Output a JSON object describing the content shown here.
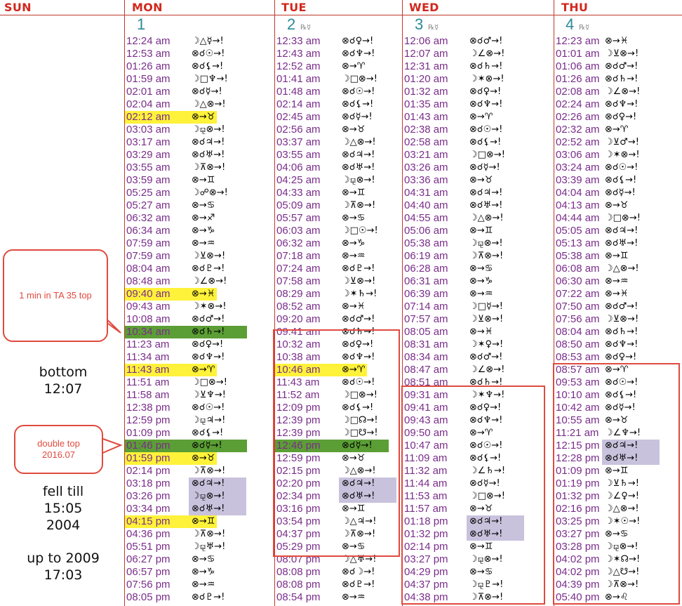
{
  "days": [
    {
      "name": "SUN",
      "num": "",
      "rx": ""
    },
    {
      "name": "MON",
      "num": "1",
      "rx": ""
    },
    {
      "name": "TUE",
      "num": "2",
      "rx": "℞☿"
    },
    {
      "name": "WED",
      "num": "3",
      "rx": "℞☿"
    },
    {
      "name": "THU",
      "num": "4",
      "rx": "℞☿"
    }
  ],
  "notes": {
    "bubble1": "1 min in TA 35 top",
    "bottom": "bottom\n12:07",
    "bubble2": "double top 2016.07",
    "fell": "fell till\n15:05\n2004",
    "upto": "up to 2009\n17:03"
  },
  "columns": [
    {
      "day": "MON",
      "rows": [
        {
          "t": "12:24 am",
          "a": "☽△☿→!"
        },
        {
          "t": "12:53 am",
          "a": "⊗☌☉→!"
        },
        {
          "t": "01:26 am",
          "a": "⊗☌⚸→!"
        },
        {
          "t": "01:59 am",
          "a": "☽□♆→!"
        },
        {
          "t": "02:01 am",
          "a": "⊗☌☿→!"
        },
        {
          "t": "02:04 am",
          "a": "☽△⊗→!"
        },
        {
          "t": "02:12 am",
          "a": "⊗→♉",
          "hl": "y"
        },
        {
          "t": "03:03 am",
          "a": "☽⚼⊗→!"
        },
        {
          "t": "03:17 am",
          "a": "⊗☌♃→!"
        },
        {
          "t": "03:29 am",
          "a": "⊗☌♅→!"
        },
        {
          "t": "03:55 am",
          "a": "☽⊼⊗→!"
        },
        {
          "t": "03:59 am",
          "a": "⊗→♊"
        },
        {
          "t": "05:25 am",
          "a": "☽☍⊗→!"
        },
        {
          "t": "05:27 am",
          "a": "⊗→♋"
        },
        {
          "t": "06:32 am",
          "a": "⊗→♐"
        },
        {
          "t": "06:34 am",
          "a": "⊗→♑"
        },
        {
          "t": "07:59 am",
          "a": "⊗→♒"
        },
        {
          "t": "07:59 am",
          "a": "☽⊻⊗→!"
        },
        {
          "t": "08:04 am",
          "a": "⊗☌♇→!"
        },
        {
          "t": "08:48 am",
          "a": "☽∠⊗→!"
        },
        {
          "t": "09:40 am",
          "a": "⊗→♓",
          "hl": "y"
        },
        {
          "t": "09:43 am",
          "a": "☽✶⊗→!"
        },
        {
          "t": "10:08 am",
          "a": "⊗☌♂→!"
        },
        {
          "t": "10:34 am",
          "a": "⊗☌♄→!",
          "hl": "g"
        },
        {
          "t": "11:23 am",
          "a": "⊗☌♀→!"
        },
        {
          "t": "11:34 am",
          "a": "⊗☌♆→!"
        },
        {
          "t": "11:43 am",
          "a": "⊗→♈",
          "hl": "y"
        },
        {
          "t": "11:51 am",
          "a": "☽□⊗→!"
        },
        {
          "t": "11:58 am",
          "a": "☽⊻♆→!"
        },
        {
          "t": "12:38 pm",
          "a": "⊗☌☉→!"
        },
        {
          "t": "12:59 pm",
          "a": "☽⚼♃→!"
        },
        {
          "t": "01:09 pm",
          "a": "⊗☌⚸→!"
        },
        {
          "t": "01:46 pm",
          "a": "⊗☌☿→!",
          "hl": "g"
        },
        {
          "t": "01:59 pm",
          "a": "⊗→♉",
          "hl": "y"
        },
        {
          "t": "02:14 pm",
          "a": "☽⊼⊗→!"
        },
        {
          "t": "03:18 pm",
          "a": "⊗☌♃→!",
          "hl": "p"
        },
        {
          "t": "03:26 pm",
          "a": "☽⚼⊗→!",
          "hl": "p"
        },
        {
          "t": "03:34 pm",
          "a": "⊗☌♅→!",
          "hl": "p"
        },
        {
          "t": "04:15 pm",
          "a": "⊗→♊",
          "hl": "y"
        },
        {
          "t": "04:36 pm",
          "a": "☽⊼⊗→!"
        },
        {
          "t": "05:51 pm",
          "a": "☽⚼♅→!"
        },
        {
          "t": "06:27 pm",
          "a": "⊗→♋"
        },
        {
          "t": "06:57 pm",
          "a": "⊗→♑"
        },
        {
          "t": "07:56 pm",
          "a": "⊗→♒"
        },
        {
          "t": "08:05 pm",
          "a": "⊗☌♇→!"
        }
      ]
    },
    {
      "day": "TUE",
      "rows": [
        {
          "t": "12:33 am",
          "a": "⊗☌♀→!"
        },
        {
          "t": "12:43 am",
          "a": "⊗☌♆→!"
        },
        {
          "t": "12:52 am",
          "a": "⊗→♈"
        },
        {
          "t": "01:41 am",
          "a": "☽□⊗→!"
        },
        {
          "t": "01:48 am",
          "a": "⊗☌☉→!"
        },
        {
          "t": "02:14 am",
          "a": "⊗☌⚸→!"
        },
        {
          "t": "02:45 am",
          "a": "⊗☌☿→!"
        },
        {
          "t": "02:56 am",
          "a": "⊗→♉"
        },
        {
          "t": "03:37 am",
          "a": "☽△⊗→!"
        },
        {
          "t": "03:55 am",
          "a": "⊗☌♃→!"
        },
        {
          "t": "04:06 am",
          "a": "⊗☌♅→!"
        },
        {
          "t": "04:25 am",
          "a": "☽⚼⊗→!"
        },
        {
          "t": "04:33 am",
          "a": "⊗→♊"
        },
        {
          "t": "05:09 am",
          "a": "☽⊼⊗→!"
        },
        {
          "t": "05:57 am",
          "a": "⊗→♋"
        },
        {
          "t": "06:03 am",
          "a": "☽□☉→!"
        },
        {
          "t": "06:32 am",
          "a": "⊗→♑"
        },
        {
          "t": "07:18 am",
          "a": "⊗→♒"
        },
        {
          "t": "07:24 am",
          "a": "⊗☌♇→!"
        },
        {
          "t": "07:58 am",
          "a": "☽⊻⊗→!"
        },
        {
          "t": "08:29 am",
          "a": "☽✶♄→!"
        },
        {
          "t": "08:52 am",
          "a": "⊗→♓"
        },
        {
          "t": "09:20 am",
          "a": "⊗☌♂→!"
        },
        {
          "t": "09:41 am",
          "a": "⊗☌♄→!"
        },
        {
          "t": "10:32 am",
          "a": "⊗☌♀→!"
        },
        {
          "t": "10:38 am",
          "a": "⊗☌♆→!"
        },
        {
          "t": "10:46 am",
          "a": "⊗→♈",
          "hl": "y"
        },
        {
          "t": "11:43 am",
          "a": "⊗☌☉→!"
        },
        {
          "t": "11:52 am",
          "a": "☽□⊗→!"
        },
        {
          "t": "12:09 pm",
          "a": "⊗☌⚸→!"
        },
        {
          "t": "12:39 pm",
          "a": "☽□☊→!"
        },
        {
          "t": "12:39 pm",
          "a": "☽□☋→!"
        },
        {
          "t": "12:46 pm",
          "a": "⊗☌☿→!",
          "hl": "g"
        },
        {
          "t": "12:59 pm",
          "a": "⊗→♉"
        },
        {
          "t": "02:15 pm",
          "a": "☽△⊗→!"
        },
        {
          "t": "02:20 pm",
          "a": "⊗☌♃→!",
          "hl": "p"
        },
        {
          "t": "02:34 pm",
          "a": "⊗☌♅→!",
          "hl": "p"
        },
        {
          "t": "03:16 pm",
          "a": "⊗→♊"
        },
        {
          "t": "03:54 pm",
          "a": "☽△♃→!"
        },
        {
          "t": "04:37 pm",
          "a": "☽⊼⊗→!"
        },
        {
          "t": "05:29 pm",
          "a": "⊗→♋"
        },
        {
          "t": "08:07 pm",
          "a": "☽△♅→!"
        },
        {
          "t": "08:08 pm",
          "a": "⊗☌☽→!"
        },
        {
          "t": "08:08 pm",
          "a": "⊗☌♇→!"
        },
        {
          "t": "08:54 pm",
          "a": "⊗→♒"
        }
      ]
    },
    {
      "day": "WED",
      "rows": [
        {
          "t": "12:06 am",
          "a": "⊗☌♂→!"
        },
        {
          "t": "12:07 am",
          "a": "☽∠⊗→!"
        },
        {
          "t": "12:31 am",
          "a": "⊗☌♄→!"
        },
        {
          "t": "01:20 am",
          "a": "☽✶⊗→!"
        },
        {
          "t": "01:32 am",
          "a": "⊗☌♀→!"
        },
        {
          "t": "01:35 am",
          "a": "⊗☌♆→!"
        },
        {
          "t": "01:43 am",
          "a": "⊗→♈"
        },
        {
          "t": "02:38 am",
          "a": "⊗☌☉→!"
        },
        {
          "t": "02:58 am",
          "a": "⊗☌⚸→!"
        },
        {
          "t": "03:21 am",
          "a": "☽□⊗→!"
        },
        {
          "t": "03:26 am",
          "a": "⊗☌☿→!"
        },
        {
          "t": "03:36 am",
          "a": "⊗→♉"
        },
        {
          "t": "04:31 am",
          "a": "⊗☌♃→!"
        },
        {
          "t": "04:40 am",
          "a": "⊗☌♅→!"
        },
        {
          "t": "04:55 am",
          "a": "☽△⊗→!"
        },
        {
          "t": "05:06 am",
          "a": "⊗→♊"
        },
        {
          "t": "05:38 am",
          "a": "☽⚼⊗→!"
        },
        {
          "t": "06:19 am",
          "a": "☽⊼⊗→!"
        },
        {
          "t": "06:28 am",
          "a": "⊗→♋"
        },
        {
          "t": "06:31 am",
          "a": "⊗→♑"
        },
        {
          "t": "06:39 am",
          "a": "⊗→♒"
        },
        {
          "t": "07:14 am",
          "a": "☽□☿→!"
        },
        {
          "t": "07:57 am",
          "a": "☽⊻⊗→!"
        },
        {
          "t": "08:05 am",
          "a": "⊗→♓"
        },
        {
          "t": "08:31 am",
          "a": "☽✶♀→!"
        },
        {
          "t": "08:34 am",
          "a": "⊗☌♂→!"
        },
        {
          "t": "08:47 am",
          "a": "☽∠⊗→!"
        },
        {
          "t": "08:51 am",
          "a": "⊗☌♄→!"
        },
        {
          "t": "09:31 am",
          "a": "☽✶♆→!"
        },
        {
          "t": "09:41 am",
          "a": "⊗☌♀→!"
        },
        {
          "t": "09:43 am",
          "a": "⊗☌♆→!"
        },
        {
          "t": "09:50 am",
          "a": "⊗→♈"
        },
        {
          "t": "10:47 am",
          "a": "⊗☌☉→!"
        },
        {
          "t": "11:09 am",
          "a": "⊗☌⚸→!"
        },
        {
          "t": "11:32 am",
          "a": "☽∠♄→!"
        },
        {
          "t": "11:44 am",
          "a": "⊗☌☿→!"
        },
        {
          "t": "11:53 am",
          "a": "☽□⊗→!"
        },
        {
          "t": "11:57 am",
          "a": "⊗→♉"
        },
        {
          "t": "01:18 pm",
          "a": "⊗☌♃→!",
          "hl": "p"
        },
        {
          "t": "01:32 pm",
          "a": "⊗☌♅→!",
          "hl": "p"
        },
        {
          "t": "02:14 pm",
          "a": "⊗→♊"
        },
        {
          "t": "03:27 pm",
          "a": "☽⚼⊗→!"
        },
        {
          "t": "04:29 pm",
          "a": "⊗→♋"
        },
        {
          "t": "04:37 pm",
          "a": "☽⚼♇→!"
        },
        {
          "t": "04:38 pm",
          "a": "☽⊼⊗→!"
        }
      ]
    },
    {
      "day": "THU",
      "rows": [
        {
          "t": "12:23 am",
          "a": "⊗→♓"
        },
        {
          "t": "01:01 am",
          "a": "☽⊻⊗→!"
        },
        {
          "t": "01:06 am",
          "a": "⊗☌♂→!"
        },
        {
          "t": "01:26 am",
          "a": "⊗☌♄→!"
        },
        {
          "t": "02:08 am",
          "a": "☽∠⊗→!"
        },
        {
          "t": "02:24 am",
          "a": "⊗☌♆→!"
        },
        {
          "t": "02:26 am",
          "a": "⊗☌♀→!"
        },
        {
          "t": "02:32 am",
          "a": "⊗→♈"
        },
        {
          "t": "02:52 am",
          "a": "☽⊻♂→!"
        },
        {
          "t": "03:06 am",
          "a": "☽✶⊗→!"
        },
        {
          "t": "03:24 am",
          "a": "⊗☌☉→!"
        },
        {
          "t": "03:39 am",
          "a": "⊗☌⚸→!"
        },
        {
          "t": "04:04 am",
          "a": "⊗☌☿→!"
        },
        {
          "t": "04:13 am",
          "a": "⊗→♉"
        },
        {
          "t": "04:44 am",
          "a": "☽□⊗→!"
        },
        {
          "t": "05:05 am",
          "a": "⊗☌♃→!"
        },
        {
          "t": "05:13 am",
          "a": "⊗☌♅→!"
        },
        {
          "t": "05:38 am",
          "a": "⊗→♊"
        },
        {
          "t": "06:08 am",
          "a": "☽△⊗→!"
        },
        {
          "t": "06:30 am",
          "a": "⊗→♒"
        },
        {
          "t": "07:22 am",
          "a": "⊗→♓"
        },
        {
          "t": "07:50 am",
          "a": "⊗☌♂→!"
        },
        {
          "t": "07:56 am",
          "a": "☽⊻⊗→!"
        },
        {
          "t": "08:04 am",
          "a": "⊗☌♄→!"
        },
        {
          "t": "08:50 am",
          "a": "⊗☌♆→!"
        },
        {
          "t": "08:53 am",
          "a": "⊗☌♀→!"
        },
        {
          "t": "08:57 am",
          "a": "⊗→♈"
        },
        {
          "t": "09:53 am",
          "a": "⊗☌☉→!"
        },
        {
          "t": "10:10 am",
          "a": "⊗☌⚸→!"
        },
        {
          "t": "10:42 am",
          "a": "⊗☌☿→!"
        },
        {
          "t": "10:55 am",
          "a": "⊗→♉"
        },
        {
          "t": "11:21 am",
          "a": "☽∠♆→!"
        },
        {
          "t": "12:15 pm",
          "a": "⊗☌♃→!",
          "hl": "p"
        },
        {
          "t": "12:28 pm",
          "a": "⊗☌♅→!",
          "hl": "p"
        },
        {
          "t": "01:09 pm",
          "a": "⊗→♊"
        },
        {
          "t": "01:19 pm",
          "a": "☽⊻♄→!"
        },
        {
          "t": "01:32 pm",
          "a": "☽∠♀→!"
        },
        {
          "t": "02:16 pm",
          "a": "☽△⊗→!"
        },
        {
          "t": "03:25 pm",
          "a": "☽✶☉→!"
        },
        {
          "t": "03:27 pm",
          "a": "⊗→♋"
        },
        {
          "t": "03:28 pm",
          "a": "☽⚼⊗→!"
        },
        {
          "t": "04:02 pm",
          "a": "☽✶☊→!"
        },
        {
          "t": "04:02 pm",
          "a": "☽△☋→!"
        },
        {
          "t": "04:39 pm",
          "a": "☽⊼⊗→!"
        },
        {
          "t": "05:40 pm",
          "a": "⊗→♌"
        }
      ]
    }
  ]
}
